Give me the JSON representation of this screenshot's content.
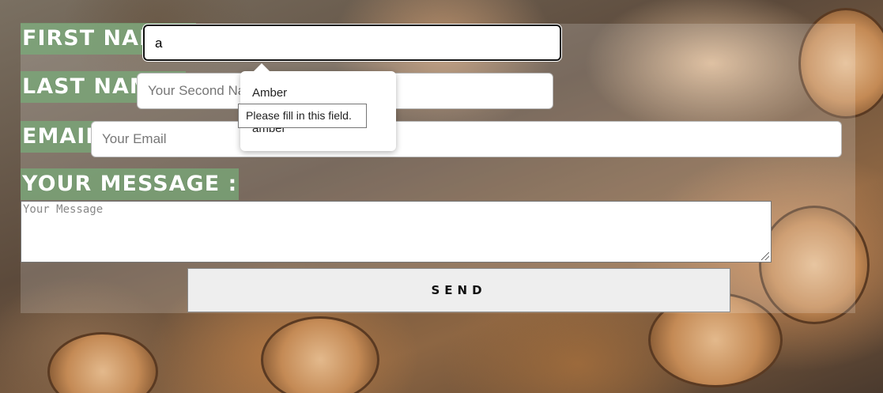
{
  "form": {
    "first_name": {
      "label": "FIRST NAME :",
      "value": "a",
      "placeholder": ""
    },
    "last_name": {
      "label": "LAST NAME :",
      "value": "",
      "placeholder": "Your Second Name"
    },
    "email": {
      "label": "EMAIL :",
      "value": "",
      "placeholder": "Your Email"
    },
    "message": {
      "label": "YOUR MESSAGE :",
      "value": "",
      "placeholder": "Your Message"
    },
    "send_label": "SEND"
  },
  "autocomplete": {
    "items": [
      "Amber",
      "amber"
    ]
  },
  "tooltip": {
    "text": "Please fill in this field."
  },
  "colors": {
    "label_bg": "#78aa78",
    "label_text": "#ffffff"
  }
}
